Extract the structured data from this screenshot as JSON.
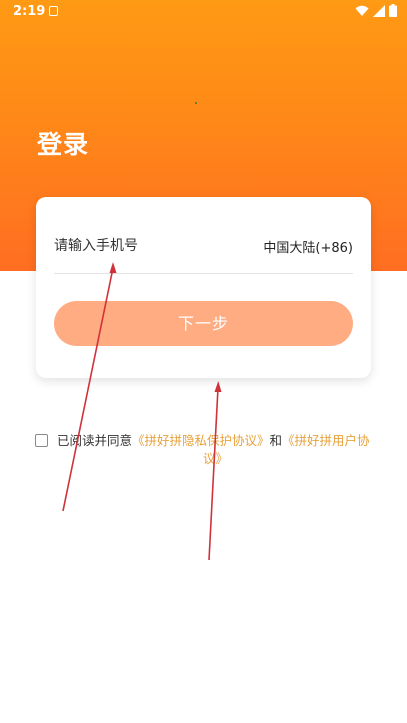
{
  "status_bar": {
    "time": "2:19"
  },
  "login": {
    "title": "登录",
    "phone_placeholder": "请输入手机号",
    "region": "中国大陆(+86)",
    "next_button": "下一步"
  },
  "agreement": {
    "prefix": "已阅读并同意",
    "privacy_link": "《拼好拼隐私保护协议》",
    "and": "和",
    "user_link": "《拼好拼用户协",
    "user_link_cont": "议》"
  },
  "colors": {
    "header_gradient_top": "#ff9a14",
    "header_gradient_bottom": "#ff6e22",
    "button": "#ffac83",
    "link": "#e6a23c",
    "annotation_arrow": "#d0323a"
  }
}
